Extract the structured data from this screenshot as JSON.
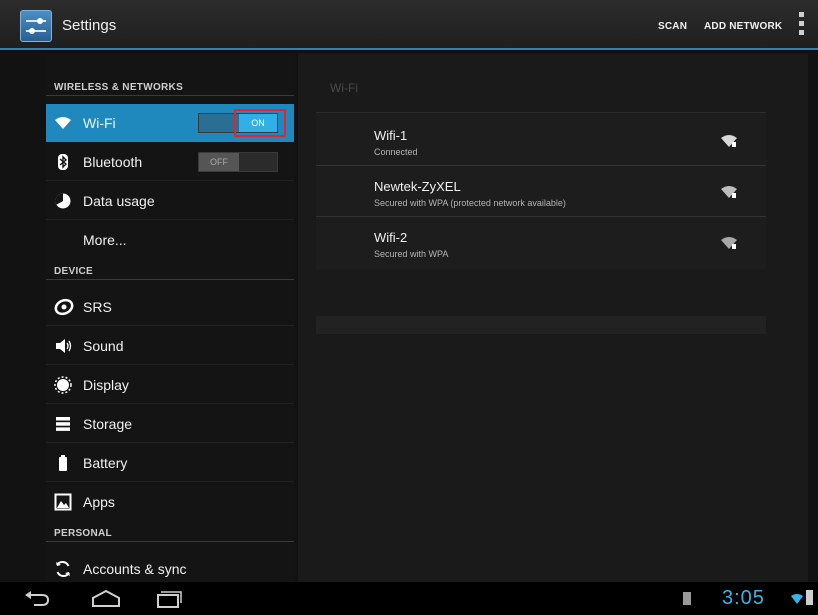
{
  "actionbar": {
    "title": "Settings",
    "scan_label": "SCAN",
    "add_network_label": "ADD NETWORK",
    "icons": {
      "app": "settings-sliders-icon",
      "overflow": "overflow-menu-icon"
    }
  },
  "left_pane": {
    "section_wireless": "WIRELESS & NETWORKS",
    "wifi": {
      "label": "Wi-Fi",
      "icon": "wifi-icon",
      "toggle": "ON"
    },
    "bluetooth": {
      "label": "Bluetooth",
      "icon": "bluetooth-icon",
      "toggle": "OFF"
    },
    "data_usage": {
      "label": "Data usage",
      "icon": "data-usage-icon"
    },
    "more": {
      "label": "More..."
    },
    "section_device": "DEVICE",
    "srs": {
      "label": "SRS",
      "icon": "srs-icon"
    },
    "sound": {
      "label": "Sound",
      "icon": "speaker-icon"
    },
    "display": {
      "label": "Display",
      "icon": "display-icon"
    },
    "storage": {
      "label": "Storage",
      "icon": "storage-icon"
    },
    "battery": {
      "label": "Battery",
      "icon": "battery-icon"
    },
    "apps": {
      "label": "Apps",
      "icon": "apps-icon"
    },
    "section_personal": "PERSONAL",
    "accounts": {
      "label": "Accounts & sync",
      "icon": "sync-icon"
    }
  },
  "right_pane": {
    "title": "Wi-Fi",
    "networks": [
      {
        "name": "Wifi-1",
        "status": "Connected"
      },
      {
        "name": "Newtek-ZyXEL",
        "status": "Secured with WPA (protected network available)"
      },
      {
        "name": "Wifi-2",
        "status": "Secured with WPA"
      }
    ]
  },
  "navbar": {
    "time": "3:05",
    "icons": [
      "back-icon",
      "home-icon",
      "recent-apps-icon"
    ]
  },
  "colors": {
    "accent": "#33b5e5",
    "selected": "#1f88bd",
    "highlight": "#e0262e"
  }
}
